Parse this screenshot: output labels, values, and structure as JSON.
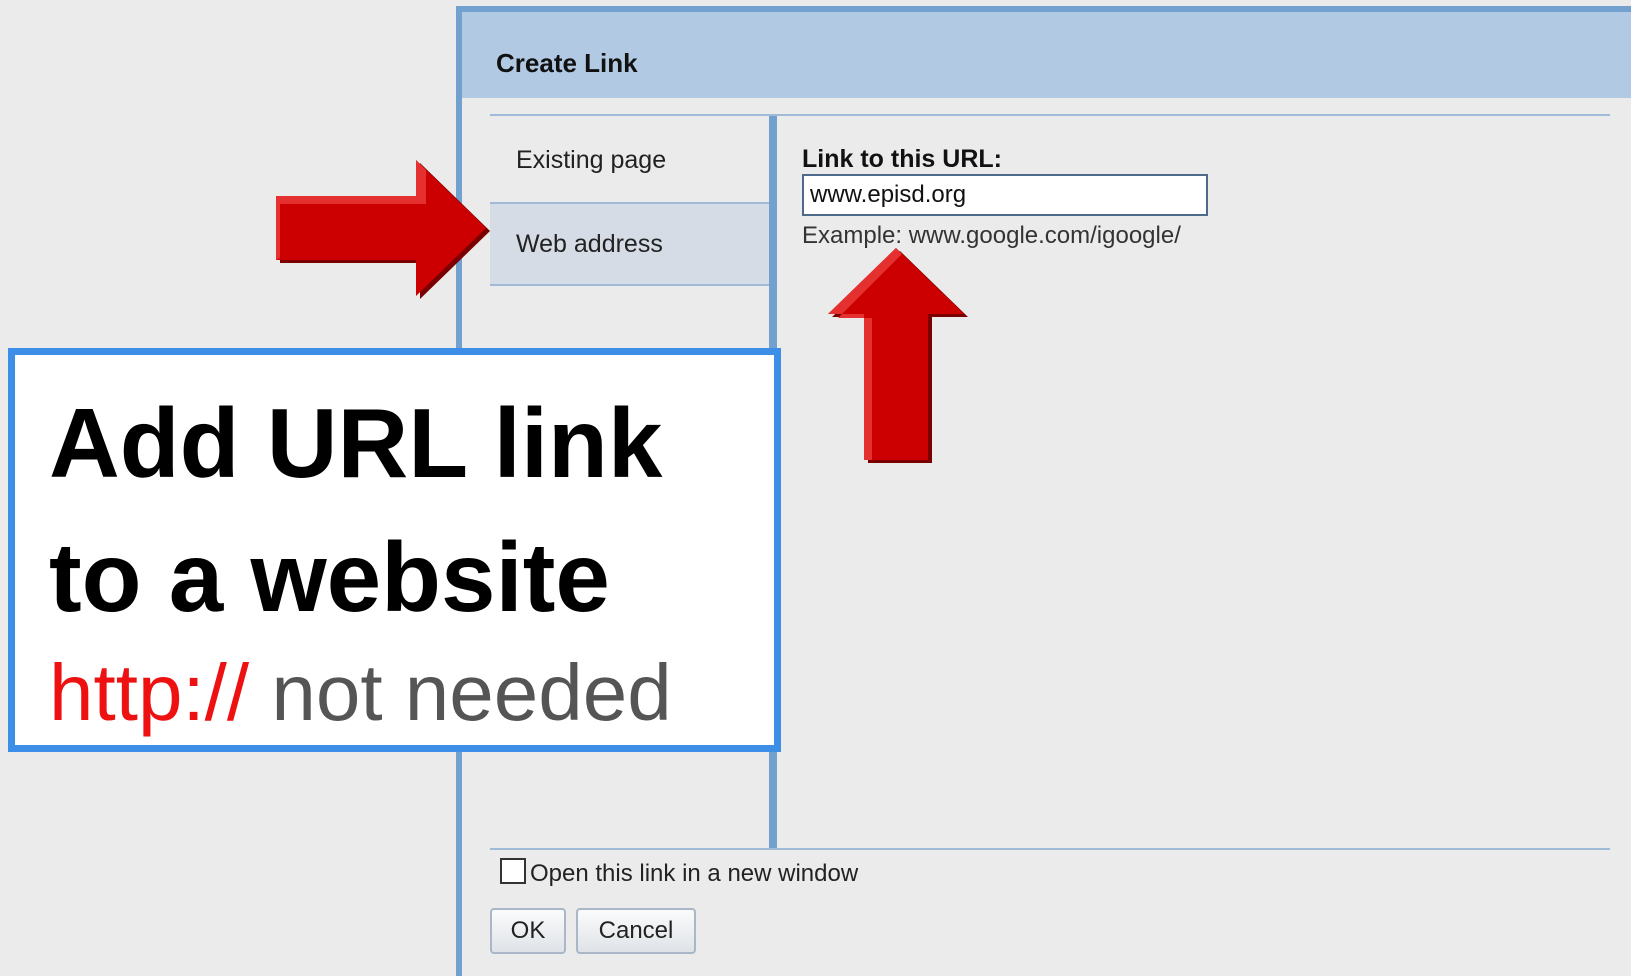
{
  "dialog": {
    "title": "Create Link",
    "sidebar": {
      "items": [
        {
          "label": "Existing page",
          "selected": false
        },
        {
          "label": "Web address",
          "selected": true
        }
      ]
    },
    "url_label": "Link to this URL:",
    "url_value": "www.episd.org",
    "example": "Example: www.google.com/igoogle/",
    "new_window_label": "Open this link in a new window",
    "new_window_checked": false,
    "ok_label": "OK",
    "cancel_label": "Cancel"
  },
  "callout": {
    "line1": "Add URL link",
    "line2": "to a website",
    "protocol": "http://",
    "note": "not needed"
  },
  "colors": {
    "arrow": "#cc0000",
    "callout_border": "#3d8ee6",
    "dialog_border": "#72a1cf",
    "dialog_header": "#b1c9e2",
    "http_text": "#ee1111"
  }
}
